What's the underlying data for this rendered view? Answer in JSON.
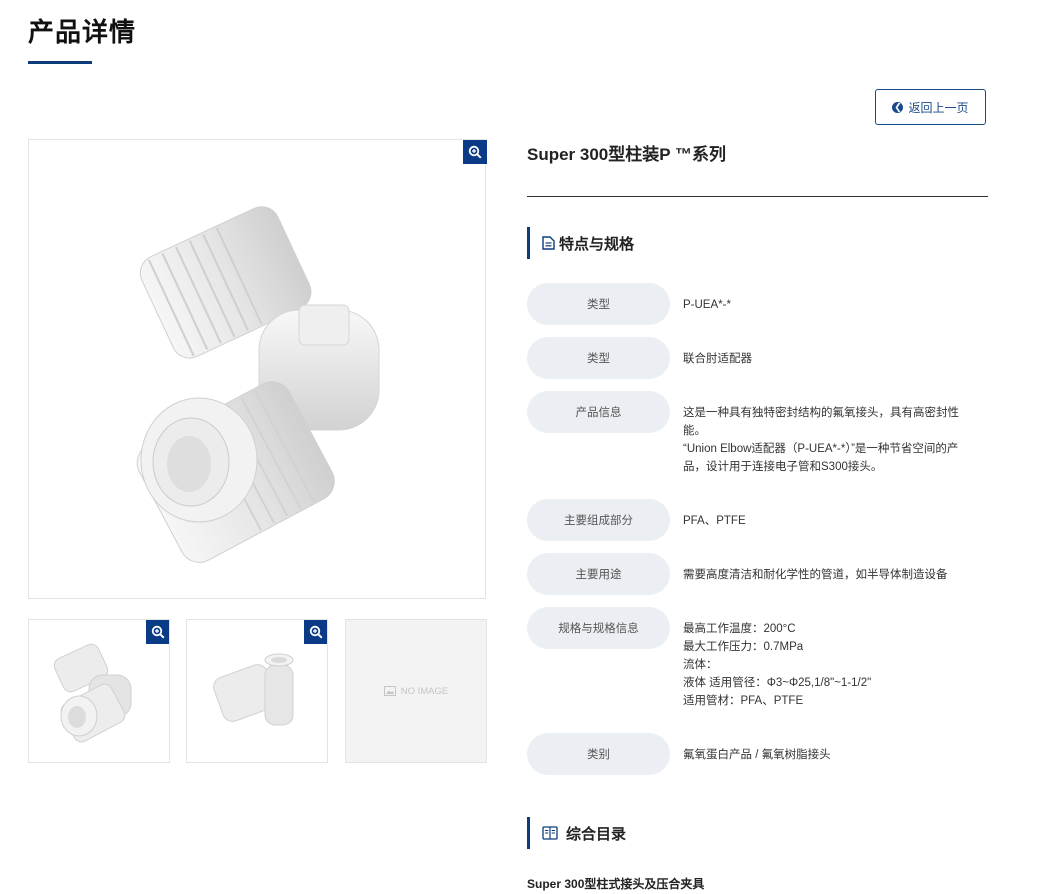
{
  "page": {
    "title": "产品详情",
    "back_label": "返回上一页"
  },
  "product": {
    "name": "Super 300型柱装P ™系列",
    "no_image_label": "NO IMAGE"
  },
  "specs": {
    "heading": "特点与规格",
    "rows": [
      {
        "label": "类型",
        "value": "P-UEA*-*"
      },
      {
        "label": "类型",
        "value": "联合肘适配器"
      },
      {
        "label": "产品信息",
        "value": "这是一种具有独特密封结构的氟氧接头，具有高密封性\n能。\n“Union Elbow适配器（P-UEA*-*）”是一种节省空间的产\n品，设计用于连接电子管和S300接头。"
      },
      {
        "label": "主要组成部分",
        "value": "PFA、PTFE"
      },
      {
        "label": "主要用途",
        "value": "需要高度清洁和耐化学性的管道，如半导体制造设备"
      },
      {
        "label": "规格与规格信息",
        "value": "最高工作温度：200°C\n最大工作压力：0.7MPa\n流体：\n液体 适用管径：Φ3~Φ25,1/8\"~1-1/2\"\n适用管材：PFA、PTFE"
      },
      {
        "label": "类别",
        "value": "氟氧蛋白产品 / 氟氧树脂接头"
      }
    ]
  },
  "catalog": {
    "heading": "综合目录",
    "items": [
      "Super 300型柱式接头及压合夹具"
    ]
  },
  "colors": {
    "accent": "#0c3d7a",
    "zoom_bg": "#0b3b86",
    "label_bg": "#ebeef2"
  },
  "icons": [
    "zoom-in-icon",
    "back-arrow-icon",
    "document-icon",
    "book-icon",
    "image-placeholder-icon"
  ]
}
